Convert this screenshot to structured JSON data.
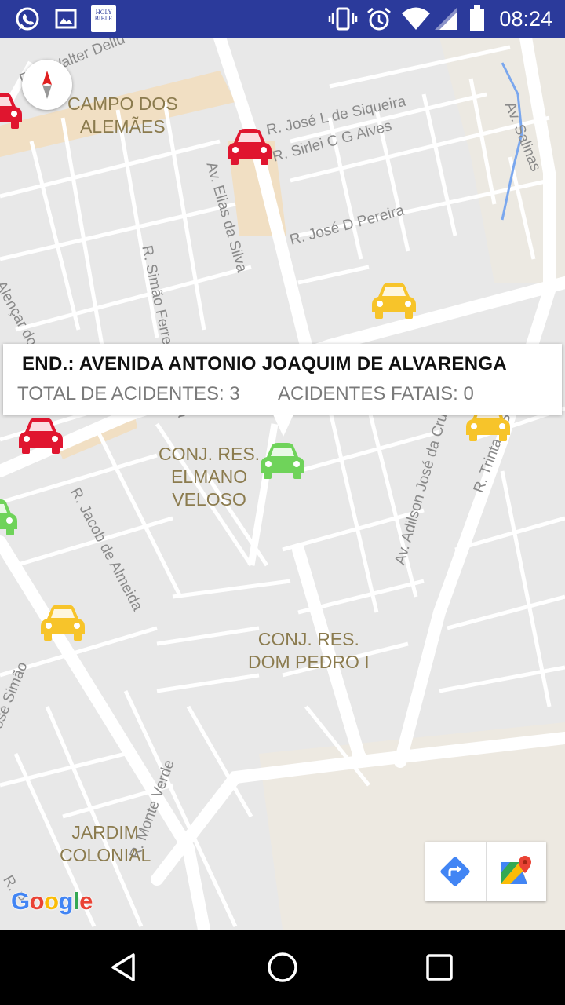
{
  "status_bar": {
    "time": "08:24",
    "icons": [
      "whatsapp-icon",
      "gallery-icon",
      "bible-app-icon",
      "vibrate-icon",
      "alarm-icon",
      "wifi-icon",
      "signal-icon",
      "battery-icon"
    ],
    "bible_icon_text": "HOLY BIBLE",
    "background": "#2b3a9b"
  },
  "map": {
    "street_labels": [
      "Rua Walter Dellu",
      "R. José L de Siqueira",
      "R. Sirlei C G Alves",
      "Av. Salinas",
      "Av. Elias da Silva",
      "R. Simão Ferreira da Mata",
      "R. Alençar dos Santos",
      "R. José D Pereira",
      "R. Jacob de Almeida",
      "Av. Adilson José da Cruz",
      "R. Trinta e Sete",
      "R. José Simão",
      "R. Monte Verde",
      "R. P"
    ],
    "district_labels": [
      "CAMPO DOS\nALEMÃES",
      "CONJ. RES.\nELMANO\nVELOSO",
      "CONJ. RES.\nDOM PEDRO I",
      "JARDIM\nCOLONIAL"
    ],
    "markers": [
      {
        "name": "red-car-marker",
        "color": "#e0152f"
      },
      {
        "name": "red-car-marker",
        "color": "#e0152f"
      },
      {
        "name": "red-car-marker",
        "color": "#e0152f"
      },
      {
        "name": "yellow-car-marker",
        "color": "#f7c42a"
      },
      {
        "name": "yellow-car-marker",
        "color": "#f7c42a"
      },
      {
        "name": "yellow-car-marker",
        "color": "#f7c42a"
      },
      {
        "name": "green-car-marker",
        "color": "#6fd35a"
      },
      {
        "name": "green-car-marker",
        "color": "#6fd35a"
      }
    ]
  },
  "info_window": {
    "title": "END.: AVENIDA ANTONIO JOAQUIM DE ALVARENGA",
    "total": "TOTAL DE ACIDENTES: 3",
    "fatal": "ACIDENTES FATAIS: 0"
  },
  "map_toolbar": {
    "buttons": [
      "directions-icon",
      "google-maps-icon"
    ]
  },
  "logo": {
    "letters": [
      {
        "ch": "G",
        "color": "#4285f4"
      },
      {
        "ch": "o",
        "color": "#ea4335"
      },
      {
        "ch": "o",
        "color": "#fbbc05"
      },
      {
        "ch": "g",
        "color": "#4285f4"
      },
      {
        "ch": "l",
        "color": "#34a853"
      },
      {
        "ch": "e",
        "color": "#ea4335"
      }
    ]
  },
  "nav_bar": {
    "buttons": [
      "back-icon",
      "home-icon",
      "recents-icon"
    ]
  }
}
